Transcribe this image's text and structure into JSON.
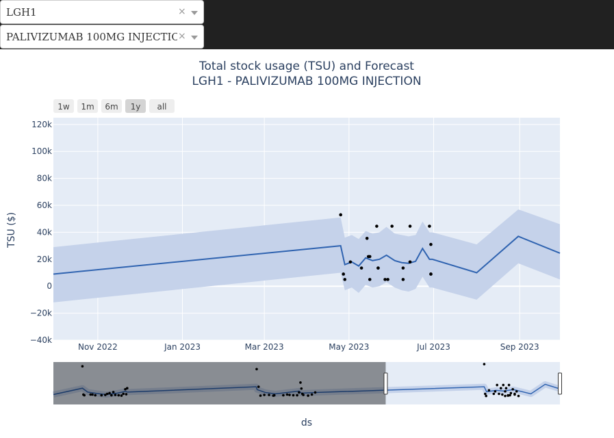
{
  "controls": {
    "facility": {
      "value": "LGH1",
      "clear": "×"
    },
    "product": {
      "value": "PALIVIZUMAB 100MG INJECTION",
      "clear": "×"
    }
  },
  "range_buttons": [
    "1w",
    "1m",
    "6m",
    "1y",
    "all"
  ],
  "active_range": "1y",
  "colors": {
    "line": "#2f63b0",
    "band": "#c5d2ea",
    "plot_bg": "#e5ecf6",
    "points": "#000000"
  },
  "chart_data": {
    "type": "line",
    "title": "Total stock usage (TSU) and Forecast",
    "subtitle": "LGH1 - PALIVIZUMAB 100MG INJECTION",
    "xlabel": "ds",
    "ylabel": "TSU ($)",
    "xlim": [
      "2022-09-30",
      "2023-09-30"
    ],
    "ylim": [
      -40000,
      125000
    ],
    "yticks": [
      -40000,
      -20000,
      0,
      20000,
      40000,
      60000,
      80000,
      100000,
      120000
    ],
    "ytick_labels": [
      "−40k",
      "−20k",
      "0",
      "20k",
      "40k",
      "60k",
      "80k",
      "100k",
      "120k"
    ],
    "xticks": [
      "2022-11-01",
      "2023-01-01",
      "2023-03-01",
      "2023-05-01",
      "2023-07-01",
      "2023-09-01"
    ],
    "xtick_labels": [
      "Nov 2022",
      "Jan 2023",
      "Mar 2023",
      "May 2023",
      "Jul 2023",
      "Sep 2023"
    ],
    "grid": true,
    "series": [
      {
        "type": "line",
        "x": [
          "2022-09-30",
          "2023-04-25",
          "2023-04-28",
          "2023-05-03",
          "2023-05-08",
          "2023-05-13",
          "2023-05-18",
          "2023-05-23",
          "2023-05-28",
          "2023-06-03",
          "2023-06-08",
          "2023-06-13",
          "2023-06-18",
          "2023-06-23",
          "2023-06-28",
          "2023-06-30",
          "2023-08-01",
          "2023-08-31",
          "2023-09-30"
        ],
        "y": [
          9000,
          30000,
          16000,
          18000,
          15000,
          21000,
          19000,
          20000,
          23000,
          19000,
          17500,
          17000,
          18500,
          28000,
          20000,
          20000,
          10000,
          37000,
          24500
        ]
      },
      {
        "type": "band",
        "x": [
          "2022-09-30",
          "2023-04-25",
          "2023-04-28",
          "2023-05-03",
          "2023-05-08",
          "2023-05-13",
          "2023-05-18",
          "2023-05-23",
          "2023-05-28",
          "2023-06-03",
          "2023-06-08",
          "2023-06-13",
          "2023-06-18",
          "2023-06-23",
          "2023-06-28",
          "2023-06-30",
          "2023-08-01",
          "2023-08-31",
          "2023-09-30"
        ],
        "upper": [
          29000,
          51000,
          36000,
          38000,
          35000,
          41000,
          39000,
          40000,
          44000,
          39000,
          38000,
          37000,
          38000,
          48000,
          40000,
          40000,
          31000,
          57000,
          46000
        ],
        "lower": [
          -12000,
          10000,
          -3000,
          -1000,
          -5000,
          1000,
          -1000,
          0,
          3000,
          -1000,
          -3000,
          -4000,
          -2000,
          7000,
          -1000,
          -1000,
          -10000,
          17000,
          5000
        ]
      },
      {
        "type": "scatter",
        "x": [
          "2023-04-25",
          "2023-04-27",
          "2023-04-28",
          "2023-05-02",
          "2023-05-10",
          "2023-05-14",
          "2023-05-15",
          "2023-05-16",
          "2023-05-16",
          "2023-05-21",
          "2023-05-22",
          "2023-05-22",
          "2023-05-27",
          "2023-05-29",
          "2023-06-01",
          "2023-06-09",
          "2023-06-09",
          "2023-06-14",
          "2023-06-14",
          "2023-06-14",
          "2023-06-28",
          "2023-06-29",
          "2023-06-29",
          "2023-06-29"
        ],
        "y": [
          53000,
          9000,
          5000,
          18000,
          13500,
          35500,
          22000,
          5000,
          22000,
          44500,
          13500,
          13500,
          5000,
          5000,
          44500,
          13500,
          5000,
          18000,
          18000,
          44500,
          44500,
          31000,
          9000,
          9000
        ]
      }
    ],
    "rangeslider": {
      "xlim": [
        "2020-11-01",
        "2023-10-01"
      ],
      "selected": [
        "2022-09-30",
        "2023-09-30"
      ],
      "ylim": [
        -20000,
        100000
      ],
      "points": [
        [
          "2021-01-01",
          88000
        ],
        [
          "2021-01-03",
          8000
        ],
        [
          "2021-01-05",
          6000
        ],
        [
          "2021-01-18",
          8000
        ],
        [
          "2021-01-22",
          8000
        ],
        [
          "2021-01-28",
          6000
        ],
        [
          "2021-02-10",
          6000
        ],
        [
          "2021-02-18",
          7000
        ],
        [
          "2021-02-22",
          10000
        ],
        [
          "2021-02-27",
          12000
        ],
        [
          "2021-03-03",
          6000
        ],
        [
          "2021-03-07",
          15000
        ],
        [
          "2021-03-11",
          7000
        ],
        [
          "2021-03-18",
          6000
        ],
        [
          "2021-03-24",
          5000
        ],
        [
          "2021-03-28",
          10000
        ],
        [
          "2021-04-01",
          23000
        ],
        [
          "2021-04-03",
          9000
        ],
        [
          "2021-04-05",
          26000
        ],
        [
          "2022-01-02",
          80000
        ],
        [
          "2022-01-06",
          30000
        ],
        [
          "2022-01-10",
          5000
        ],
        [
          "2022-01-18",
          7000
        ],
        [
          "2022-01-28",
          7000
        ],
        [
          "2022-02-06",
          5000
        ],
        [
          "2022-02-08",
          6000
        ],
        [
          "2022-02-27",
          6000
        ],
        [
          "2022-03-07",
          8000
        ],
        [
          "2022-03-12",
          7000
        ],
        [
          "2022-03-20",
          6000
        ],
        [
          "2022-03-28",
          6000
        ],
        [
          "2022-04-01",
          14000
        ],
        [
          "2022-04-04",
          42000
        ],
        [
          "2022-04-06",
          25000
        ],
        [
          "2022-04-08",
          10000
        ],
        [
          "2022-04-10",
          7000
        ],
        [
          "2022-04-20",
          5000
        ],
        [
          "2022-04-28",
          8000
        ],
        [
          "2022-05-05",
          14000
        ],
        [
          "2023-04-25",
          94000
        ],
        [
          "2023-04-27",
          10000
        ],
        [
          "2023-04-29",
          4000
        ],
        [
          "2023-05-05",
          20000
        ],
        [
          "2023-05-15",
          10000
        ],
        [
          "2023-05-18",
          17000
        ],
        [
          "2023-05-22",
          35000
        ],
        [
          "2023-05-26",
          10000
        ],
        [
          "2023-05-30",
          26000
        ],
        [
          "2023-06-02",
          8000
        ],
        [
          "2023-06-04",
          35000
        ],
        [
          "2023-06-08",
          17000
        ],
        [
          "2023-06-10",
          26000
        ],
        [
          "2023-06-14",
          6000
        ],
        [
          "2023-06-16",
          35000
        ],
        [
          "2023-06-20",
          12000
        ],
        [
          "2023-06-24",
          23000
        ],
        [
          "2023-06-28",
          8000
        ],
        [
          "2023-07-02",
          17000
        ],
        [
          "2023-07-06",
          4000
        ],
        [
          "2023-06-08",
          4000
        ],
        [
          "2023-06-14",
          5000
        ],
        [
          "2023-06-18",
          6000
        ],
        [
          "2023-06-28",
          10000
        ]
      ],
      "line_x": [
        "2020-11-01",
        "2021-01-01",
        "2021-01-12",
        "2021-02-01",
        "2021-02-20",
        "2021-03-15",
        "2021-04-01",
        "2021-04-06",
        "2022-01-01",
        "2022-01-03",
        "2022-01-20",
        "2022-02-10",
        "2022-03-01",
        "2022-04-01",
        "2022-04-06",
        "2022-05-10",
        "2023-04-25",
        "2023-04-30",
        "2023-05-20",
        "2023-06-05",
        "2023-06-25",
        "2023-07-02",
        "2023-08-01",
        "2023-08-31",
        "2023-09-30"
      ],
      "line_y": [
        8000,
        26000,
        15000,
        11000,
        8000,
        12000,
        17000,
        15000,
        30000,
        22000,
        14000,
        10000,
        13000,
        18000,
        12000,
        14000,
        30000,
        16000,
        20000,
        18000,
        22000,
        20000,
        10000,
        37000,
        24500
      ]
    }
  }
}
